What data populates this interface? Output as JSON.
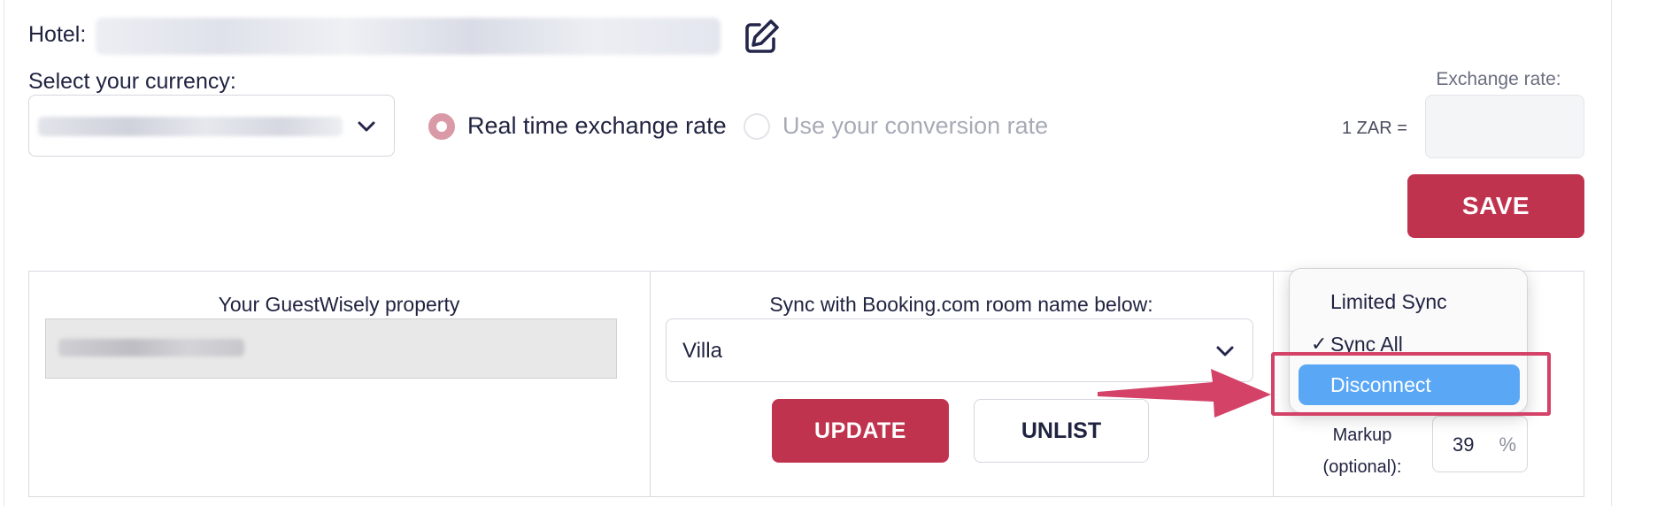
{
  "hotel": {
    "label": "Hotel:",
    "name_redacted": true
  },
  "currency": {
    "label": "Select your currency:",
    "selected_redacted": true,
    "rate_options": [
      {
        "label": "Real time exchange rate",
        "selected": true
      },
      {
        "label": "Use your conversion rate",
        "selected": false
      }
    ],
    "exchange_rate_label": "Exchange rate:",
    "base_rate_prefix": "1 ZAR =",
    "exchange_rate_value": ""
  },
  "actions": {
    "save_label": "SAVE",
    "update_label": "UPDATE",
    "unlist_label": "UNLIST"
  },
  "property": {
    "title": "Your GuestWisely property",
    "value_redacted": true
  },
  "sync": {
    "title": "Sync with Booking.com room name below:",
    "room_selected": "Villa"
  },
  "sync_mode_menu": {
    "items": [
      {
        "label": "Limited Sync",
        "checked": false,
        "highlighted": false
      },
      {
        "label": "Sync All",
        "checked": true,
        "highlighted": false
      },
      {
        "label": "Disconnect",
        "checked": false,
        "highlighted": true
      }
    ],
    "check_glyph": "✓"
  },
  "markup": {
    "label_line1": "Markup",
    "label_line2": "(optional):",
    "value": "39",
    "unit": "%"
  },
  "colors": {
    "primary": "#c0334f",
    "radio_selected": "#d999a6",
    "menu_highlight": "#5aa8f5",
    "annotation": "#d44268"
  },
  "icons": {
    "edit": "edit-icon",
    "chevron": "chevron-down-icon",
    "check": "checkmark-icon"
  }
}
